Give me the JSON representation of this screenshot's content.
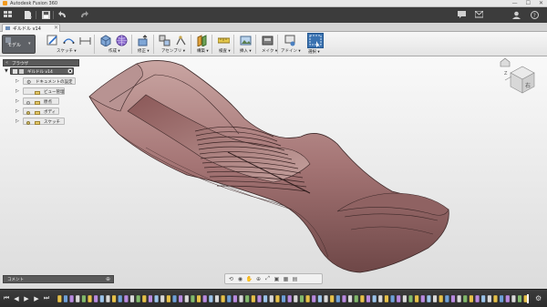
{
  "window": {
    "title": "Autodesk Fusion 360",
    "controls": [
      "—",
      "☐",
      "✕"
    ]
  },
  "document_tab": {
    "name": "ギルドル v14",
    "close": "✕"
  },
  "workspace": {
    "label": "モデル",
    "caret": "▾"
  },
  "ribbon_groups": [
    {
      "label": "スケッチ ▾"
    },
    {
      "label": "作成 ▾"
    },
    {
      "label": "修正 ▾"
    },
    {
      "label": "アセンブリ ▾"
    },
    {
      "label": "構築 ▾"
    },
    {
      "label": "検査 ▾"
    },
    {
      "label": "挿入 ▾"
    },
    {
      "label": "メイク ▾"
    },
    {
      "label": "アドイン ▾"
    },
    {
      "label": "選択 ▾"
    }
  ],
  "browser": {
    "header": "ブラウザ",
    "root": {
      "label": "ギルドル v14"
    },
    "items": [
      {
        "label": "ドキュメントの設定",
        "icon": "gear-icon"
      },
      {
        "label": "ビュー管理",
        "icon": "folder-icon"
      },
      {
        "label": "原点",
        "icon": "folder-icon"
      },
      {
        "label": "ボディ",
        "icon": "folder-icon"
      },
      {
        "label": "スケッチ",
        "icon": "folder-icon"
      }
    ]
  },
  "comments": {
    "label": "コメント",
    "add": "⊕"
  },
  "viewcube": {
    "face_label": "右",
    "compass_label": "Z"
  },
  "navbar_icons": [
    "orbit-icon",
    "look-at-icon",
    "pan-icon",
    "zoom-icon",
    "fit-icon",
    "display-settings-icon",
    "grid-icon",
    "viewports-icon"
  ],
  "timeline": {
    "controls": [
      "⏮",
      "◀",
      "▶",
      "▶",
      "⏭"
    ],
    "feature_count": 78
  },
  "colors": {
    "model_fill": "#a97c7c",
    "model_edge": "#3f2a2a",
    "selection_blue": "#3a72b0",
    "ribbon_dark": "#3c3c3c"
  }
}
